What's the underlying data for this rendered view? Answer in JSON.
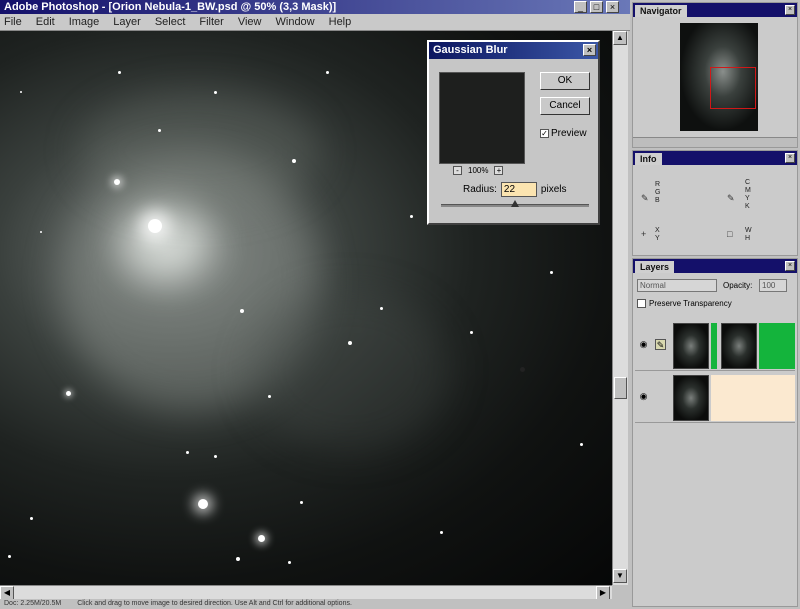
{
  "app": {
    "title": "Adobe Photoshop - [Orion Nebula-1_BW.psd @ 50% (3,3 Mask)]",
    "menu": [
      "File",
      "Edit",
      "Image",
      "Layer",
      "Select",
      "Filter",
      "View",
      "Window",
      "Help"
    ]
  },
  "status": {
    "doc": "Doc: 2.25M/20.5M",
    "hint": "Click and drag to move image to desired direction. Use Alt and Ctrl for additional options."
  },
  "dialog": {
    "title": "Gaussian Blur",
    "ok_label": "OK",
    "cancel_label": "Cancel",
    "preview_label": "Preview",
    "preview_checked": true,
    "zoom_percent": "100%",
    "radius_label": "Radius:",
    "radius_value": "22",
    "radius_unit": "pixels",
    "radius_slider_fraction": 0.5
  },
  "navigator": {
    "tab": "Navigator"
  },
  "info": {
    "tab": "Info",
    "tl_letters": "R\nG\nB",
    "tr_letters": "C\nM\nY\nK",
    "bl_letters": "X\nY",
    "br_letters": "W\nH"
  },
  "layers": {
    "tab": "Layers",
    "blend_mode": "Normal",
    "opacity_label": "Opacity:",
    "opacity_value": "100",
    "preserve_label": "Preserve Transparency",
    "rows": [
      {
        "name": "",
        "has_mask": true
      },
      {
        "name": "",
        "has_mask": false
      }
    ]
  },
  "colors": {
    "titlebar": "#14106a",
    "panel_bg": "#cbcbcb",
    "mask_green": "#14b43c",
    "radius_field": "#fbe4b0",
    "nav_rect": "#d01818"
  },
  "icons": [
    "minimize-icon",
    "maximize-icon",
    "close-icon",
    "eye-icon",
    "brush-icon",
    "eyedropper-icon",
    "crosshair-icon",
    "selection-icon"
  ]
}
